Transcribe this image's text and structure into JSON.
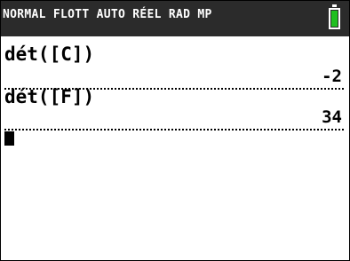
{
  "status_bar": {
    "text": "NORMAL FLOTT AUTO RÉEL RAD MP",
    "battery_level": 1.0,
    "battery_color": "#20c020"
  },
  "history": [
    {
      "input": "dét([C])",
      "result": "-2"
    },
    {
      "input": "dét([F])",
      "result": "34"
    }
  ]
}
